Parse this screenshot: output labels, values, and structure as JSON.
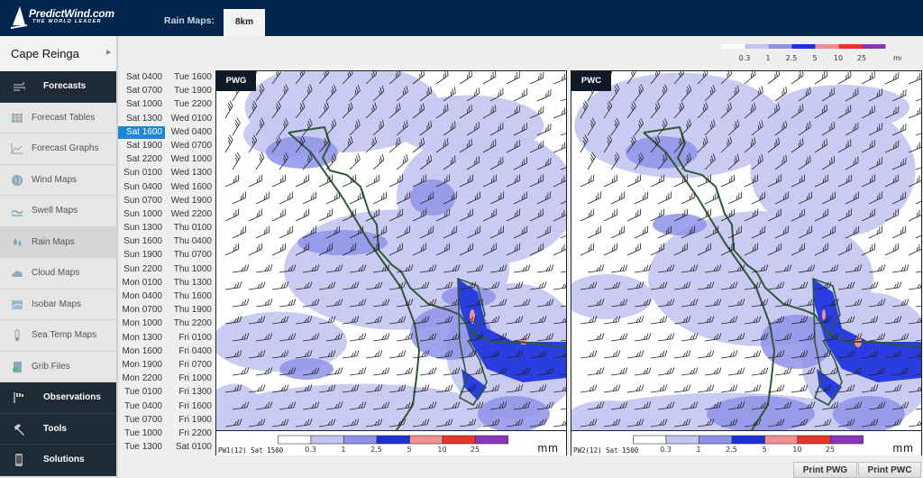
{
  "header": {
    "brand": "PredictWind.com",
    "tagline": "THE WORLD LEADER",
    "section_label": "Rain Maps:",
    "resolution_tab": "8km"
  },
  "sidebar": {
    "location": "Cape Reinga",
    "items": [
      {
        "label": "Forecasts",
        "icon": "wind-icon",
        "style": "dark"
      },
      {
        "label": "Forecast Tables",
        "icon": "table-icon",
        "style": "light"
      },
      {
        "label": "Forecast Graphs",
        "icon": "graph-icon",
        "style": "light"
      },
      {
        "label": "Wind Maps",
        "icon": "globe-icon",
        "style": "light"
      },
      {
        "label": "Swell Maps",
        "icon": "wave-icon",
        "style": "light"
      },
      {
        "label": "Rain Maps",
        "icon": "raindrop-icon",
        "style": "selected"
      },
      {
        "label": "Cloud Maps",
        "icon": "cloud-icon",
        "style": "light"
      },
      {
        "label": "Isobar Maps",
        "icon": "isobar-icon",
        "style": "light"
      },
      {
        "label": "Sea Temp Maps",
        "icon": "thermometer-icon",
        "style": "light"
      },
      {
        "label": "Grib Files",
        "icon": "grib-file-icon",
        "style": "light"
      },
      {
        "label": "Observations",
        "icon": "flags-icon",
        "style": "dark"
      },
      {
        "label": "Tools",
        "icon": "hammer-icon",
        "style": "dark"
      },
      {
        "label": "Solutions",
        "icon": "phone-icon",
        "style": "dark"
      }
    ]
  },
  "timesteps": {
    "selected": "Sat 1600",
    "col1": [
      "Sat 0400",
      "Sat 0700",
      "Sat 1000",
      "Sat 1300",
      "Sat 1600",
      "Sat 1900",
      "Sat 2200",
      "Sun 0100",
      "Sun 0400",
      "Sun 0700",
      "Sun 1000",
      "Sun 1300",
      "Sun 1600",
      "Sun 1900",
      "Sun 2200",
      "Mon 0100",
      "Mon 0400",
      "Mon 0700",
      "Mon 1000",
      "Mon 1300",
      "Mon 1600",
      "Mon 1900",
      "Mon 2200",
      "Tue 0100",
      "Tue 0400",
      "Tue 0700",
      "Tue 1000",
      "Tue 1300"
    ],
    "col2": [
      "Tue 1600",
      "Tue 1900",
      "Tue 2200",
      "Wed 0100",
      "Wed 0400",
      "Wed 0700",
      "Wed 1000",
      "Wed 1300",
      "Wed 1600",
      "Wed 1900",
      "Wed 2200",
      "Thu 0100",
      "Thu 0400",
      "Thu 0700",
      "Thu 1000",
      "Thu 1300",
      "Thu 1600",
      "Thu 1900",
      "Thu 2200",
      "Fri 0100",
      "Fri 0400",
      "Fri 0700",
      "Fri 1000",
      "Fri 1300",
      "Fri 1600",
      "Fri 1900",
      "Fri 2200",
      "Sat 0100"
    ]
  },
  "legend": {
    "unit": "mm",
    "thresholds": [
      "0.3",
      "1",
      "2.5",
      "5",
      "10",
      "25"
    ],
    "colors": [
      "#ffffff",
      "#c4c6f2",
      "#8f93e8",
      "#1a2fd8",
      "#f29090",
      "#e8322a",
      "#8a35b8"
    ]
  },
  "maps": [
    {
      "badge": "PWG",
      "model_label": "PW1(12) Sat 1500",
      "print_label": "Print PWG"
    },
    {
      "badge": "PWC",
      "model_label": "PW2(12) Sat 1500",
      "print_label": "Print PWC"
    }
  ],
  "colors": {
    "header_bg": "#00264d",
    "sidebar_dark": "#1e2a36",
    "selected_time": "#1e88d6",
    "coastline": "#2d5a35"
  }
}
